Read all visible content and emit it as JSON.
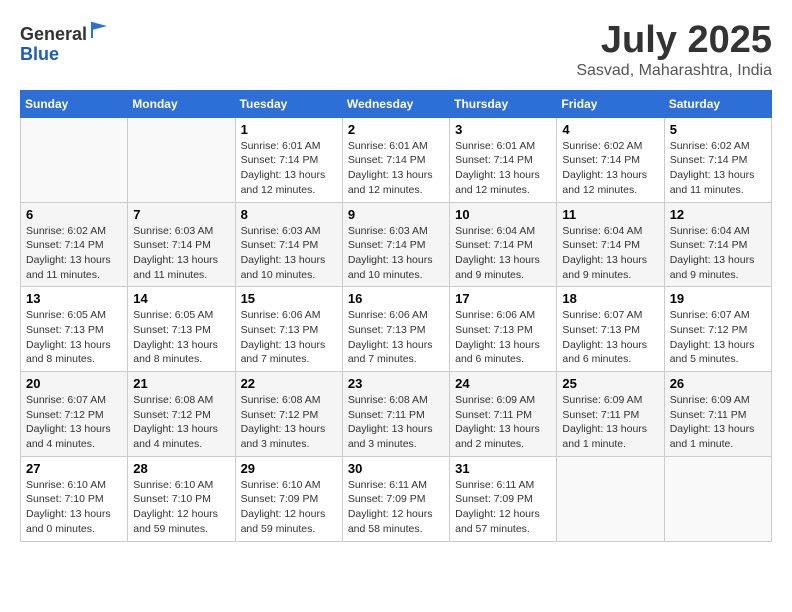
{
  "header": {
    "logo_line1": "General",
    "logo_line2": "Blue",
    "month": "July 2025",
    "location": "Sasvad, Maharashtra, India"
  },
  "days_of_week": [
    "Sunday",
    "Monday",
    "Tuesday",
    "Wednesday",
    "Thursday",
    "Friday",
    "Saturday"
  ],
  "weeks": [
    [
      {
        "day": "",
        "info": ""
      },
      {
        "day": "",
        "info": ""
      },
      {
        "day": "1",
        "info": "Sunrise: 6:01 AM\nSunset: 7:14 PM\nDaylight: 13 hours\nand 12 minutes."
      },
      {
        "day": "2",
        "info": "Sunrise: 6:01 AM\nSunset: 7:14 PM\nDaylight: 13 hours\nand 12 minutes."
      },
      {
        "day": "3",
        "info": "Sunrise: 6:01 AM\nSunset: 7:14 PM\nDaylight: 13 hours\nand 12 minutes."
      },
      {
        "day": "4",
        "info": "Sunrise: 6:02 AM\nSunset: 7:14 PM\nDaylight: 13 hours\nand 12 minutes."
      },
      {
        "day": "5",
        "info": "Sunrise: 6:02 AM\nSunset: 7:14 PM\nDaylight: 13 hours\nand 11 minutes."
      }
    ],
    [
      {
        "day": "6",
        "info": "Sunrise: 6:02 AM\nSunset: 7:14 PM\nDaylight: 13 hours\nand 11 minutes."
      },
      {
        "day": "7",
        "info": "Sunrise: 6:03 AM\nSunset: 7:14 PM\nDaylight: 13 hours\nand 11 minutes."
      },
      {
        "day": "8",
        "info": "Sunrise: 6:03 AM\nSunset: 7:14 PM\nDaylight: 13 hours\nand 10 minutes."
      },
      {
        "day": "9",
        "info": "Sunrise: 6:03 AM\nSunset: 7:14 PM\nDaylight: 13 hours\nand 10 minutes."
      },
      {
        "day": "10",
        "info": "Sunrise: 6:04 AM\nSunset: 7:14 PM\nDaylight: 13 hours\nand 9 minutes."
      },
      {
        "day": "11",
        "info": "Sunrise: 6:04 AM\nSunset: 7:14 PM\nDaylight: 13 hours\nand 9 minutes."
      },
      {
        "day": "12",
        "info": "Sunrise: 6:04 AM\nSunset: 7:14 PM\nDaylight: 13 hours\nand 9 minutes."
      }
    ],
    [
      {
        "day": "13",
        "info": "Sunrise: 6:05 AM\nSunset: 7:13 PM\nDaylight: 13 hours\nand 8 minutes."
      },
      {
        "day": "14",
        "info": "Sunrise: 6:05 AM\nSunset: 7:13 PM\nDaylight: 13 hours\nand 8 minutes."
      },
      {
        "day": "15",
        "info": "Sunrise: 6:06 AM\nSunset: 7:13 PM\nDaylight: 13 hours\nand 7 minutes."
      },
      {
        "day": "16",
        "info": "Sunrise: 6:06 AM\nSunset: 7:13 PM\nDaylight: 13 hours\nand 7 minutes."
      },
      {
        "day": "17",
        "info": "Sunrise: 6:06 AM\nSunset: 7:13 PM\nDaylight: 13 hours\nand 6 minutes."
      },
      {
        "day": "18",
        "info": "Sunrise: 6:07 AM\nSunset: 7:13 PM\nDaylight: 13 hours\nand 6 minutes."
      },
      {
        "day": "19",
        "info": "Sunrise: 6:07 AM\nSunset: 7:12 PM\nDaylight: 13 hours\nand 5 minutes."
      }
    ],
    [
      {
        "day": "20",
        "info": "Sunrise: 6:07 AM\nSunset: 7:12 PM\nDaylight: 13 hours\nand 4 minutes."
      },
      {
        "day": "21",
        "info": "Sunrise: 6:08 AM\nSunset: 7:12 PM\nDaylight: 13 hours\nand 4 minutes."
      },
      {
        "day": "22",
        "info": "Sunrise: 6:08 AM\nSunset: 7:12 PM\nDaylight: 13 hours\nand 3 minutes."
      },
      {
        "day": "23",
        "info": "Sunrise: 6:08 AM\nSunset: 7:11 PM\nDaylight: 13 hours\nand 3 minutes."
      },
      {
        "day": "24",
        "info": "Sunrise: 6:09 AM\nSunset: 7:11 PM\nDaylight: 13 hours\nand 2 minutes."
      },
      {
        "day": "25",
        "info": "Sunrise: 6:09 AM\nSunset: 7:11 PM\nDaylight: 13 hours\nand 1 minute."
      },
      {
        "day": "26",
        "info": "Sunrise: 6:09 AM\nSunset: 7:11 PM\nDaylight: 13 hours\nand 1 minute."
      }
    ],
    [
      {
        "day": "27",
        "info": "Sunrise: 6:10 AM\nSunset: 7:10 PM\nDaylight: 13 hours\nand 0 minutes."
      },
      {
        "day": "28",
        "info": "Sunrise: 6:10 AM\nSunset: 7:10 PM\nDaylight: 12 hours\nand 59 minutes."
      },
      {
        "day": "29",
        "info": "Sunrise: 6:10 AM\nSunset: 7:09 PM\nDaylight: 12 hours\nand 59 minutes."
      },
      {
        "day": "30",
        "info": "Sunrise: 6:11 AM\nSunset: 7:09 PM\nDaylight: 12 hours\nand 58 minutes."
      },
      {
        "day": "31",
        "info": "Sunrise: 6:11 AM\nSunset: 7:09 PM\nDaylight: 12 hours\nand 57 minutes."
      },
      {
        "day": "",
        "info": ""
      },
      {
        "day": "",
        "info": ""
      }
    ]
  ]
}
